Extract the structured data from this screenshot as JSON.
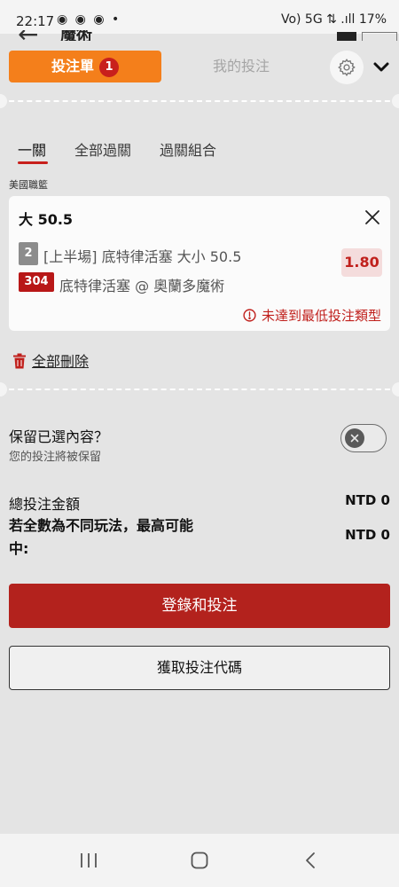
{
  "status_bar": {
    "time": "22:17",
    "notification_icons": "◉ ◉ ◉ •",
    "right_indicators": "Vo) 5G ⇅ .ıll 17%",
    "battery_percent": "17%"
  },
  "page_header": {
    "title": "魔術"
  },
  "bet_slip": {
    "tabs": {
      "bet_slip_label": "投注單",
      "bet_count": "1",
      "my_bets_label": "我的投注"
    },
    "bet_types": [
      "一關",
      "全部過關",
      "過關組合"
    ],
    "league": "美國職籃",
    "selection": {
      "title": "大 50.5",
      "period_badge": "2",
      "market": "[上半場] 底特律活塞 大小 50.5",
      "odds": "1.80",
      "match_id": "304",
      "match": "底特律活塞 @ 奧蘭多魔術",
      "warning": "未達到最低投注類型"
    },
    "delete_all_label": "全部刪除",
    "retain": {
      "title": "保留已選內容？",
      "subtitle": "您的投注將被保留",
      "enabled": false
    },
    "totals": {
      "total_stake_label": "總投注金額",
      "total_stake_value": "NTD 0",
      "max_win_label": "若全數為不同玩法，最高可能中:",
      "max_win_value": "NTD 0"
    },
    "login_bet_label": "登錄和投注",
    "get_code_label": "獲取投注代碼"
  },
  "colors": {
    "accent_orange": "#f47f1b",
    "brand_red": "#b3221d",
    "badge_red": "#c8201c",
    "sheet_bg": "#e4e4e4"
  },
  "icons": {
    "settings": "gear-icon",
    "collapse": "chevron-down-icon",
    "remove": "close-icon",
    "warning": "alert-circle-icon",
    "delete": "trash-icon",
    "toggle": "close-circle-icon"
  }
}
